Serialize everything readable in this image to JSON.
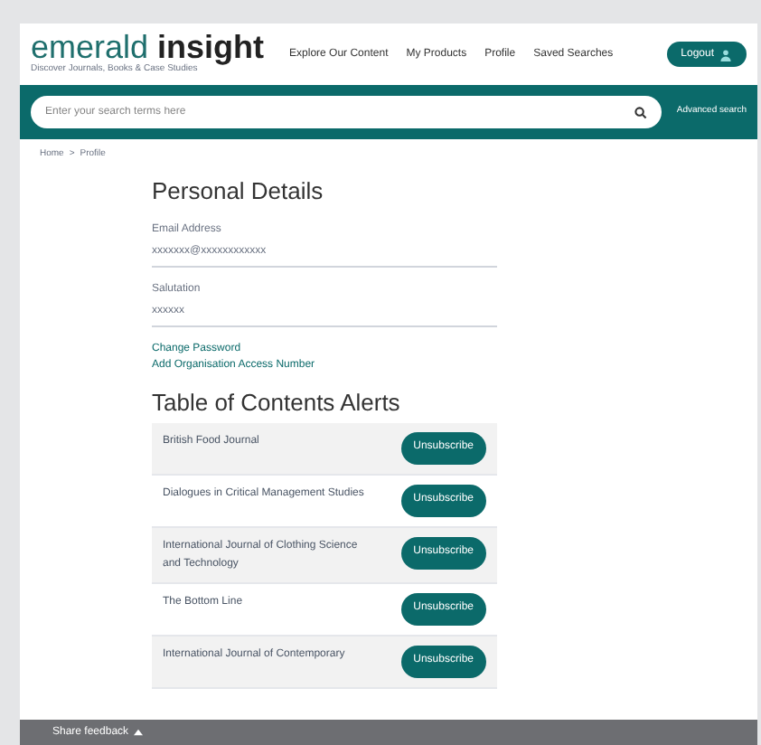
{
  "logo": {
    "name_light": "emerald",
    "name_bold": "insight",
    "tagline": "Discover Journals, Books & Case Studies"
  },
  "nav": {
    "items": [
      "Explore Our Content",
      "My Products",
      "Profile",
      "Saved Searches"
    ],
    "logout": "Logout"
  },
  "search": {
    "placeholder": "Enter your search terms here",
    "advanced": "Advanced search"
  },
  "breadcrumb": {
    "items": [
      "Home",
      "Profile"
    ],
    "separator": ">"
  },
  "personal_details": {
    "title": "Personal Details",
    "fields": [
      {
        "label": "Email Address",
        "value": "xxxxxxx@xxxxxxxxxxxx"
      },
      {
        "label": "Salutation",
        "value": "xxxxxx"
      }
    ],
    "links": [
      "Change Password",
      "Add Organisation Access Number"
    ]
  },
  "alerts": {
    "title": "Table of Contents Alerts",
    "rows": [
      {
        "journal": "British Food Journal",
        "action": "Unsubscribe"
      },
      {
        "journal": "Dialogues in Critical Management Studies",
        "action": "Unsubscribe"
      },
      {
        "journal": "International Journal of Clothing Science and Technology",
        "action": "Unsubscribe"
      },
      {
        "journal": "The Bottom Line",
        "action": "Unsubscribe"
      },
      {
        "journal": "International Journal of Contemporary",
        "action": "Unsubscribe"
      }
    ]
  },
  "feedback": {
    "label": "Share feedback"
  }
}
